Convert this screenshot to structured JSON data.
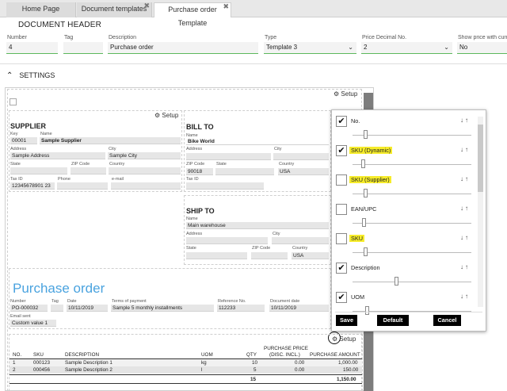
{
  "tabs": [
    {
      "label": "Home Page"
    },
    {
      "label": "Document templates"
    },
    {
      "label": "Purchase order Template"
    }
  ],
  "header": {
    "title": "DOCUMENT HEADER"
  },
  "fields": {
    "number": {
      "label": "Number",
      "value": "4"
    },
    "tag": {
      "label": "Tag",
      "value": ""
    },
    "description": {
      "label": "Description",
      "value": "Purchase order"
    },
    "type": {
      "label": "Type",
      "value": "Template 3"
    },
    "price_decimal": {
      "label": "Price Decimal No.",
      "value": "2"
    },
    "show_price": {
      "label": "Show price with curr",
      "value": "No"
    }
  },
  "settings": {
    "label": "SETTINGS"
  },
  "setup_label": "Setup",
  "supplier": {
    "title": "SUPPLIER",
    "key_label": "Key",
    "key": "00001",
    "name_label": "Name",
    "name": "Sample Supplier",
    "address_label": "Address",
    "address": "Sample Address",
    "city_label": "City",
    "city": "Sample City",
    "state_label": "State",
    "zip_label": "ZIP Code",
    "country_label": "Country",
    "taxid_label": "Tax ID",
    "taxid": "12345678901 23",
    "phone_label": "Phone",
    "email_label": "e-mail"
  },
  "billto": {
    "title": "BILL TO",
    "name_label": "Name",
    "name": "Bike World",
    "address_label": "Address",
    "city_label": "City",
    "zip_label": "ZIP Code",
    "zip": "90018",
    "state_label": "State",
    "country_label": "Country",
    "country": "USA",
    "taxid_label": "Tax ID"
  },
  "shipto": {
    "title": "SHIP TO",
    "name_label": "Name",
    "name": "Main warehouse",
    "address_label": "Address",
    "city_label": "City",
    "state_label": "State",
    "zip_label": "ZIP Code",
    "country_label": "Country",
    "country": "USA"
  },
  "po": {
    "title": "Purchase order",
    "number_label": "Number",
    "number": "PO-000032",
    "tag_label": "Tag",
    "date_label": "Date",
    "date": "10/11/2019",
    "terms_label": "Terms of payment",
    "terms": "Sample 5 monthly installments",
    "ref_label": "Reference No.",
    "ref": "112233",
    "docdate_label": "Document date",
    "docdate": "10/11/2019",
    "email_label": "Email sent",
    "email": "Custom value 1"
  },
  "table": {
    "headers": {
      "no": "NO.",
      "sku": "SKU",
      "description": "DESCRIPTION",
      "uom": "UOM",
      "qty": "QTY",
      "price1": "PURCHASE PRICE",
      "price2": "(DISC. INCL.)",
      "amount": "PURCHASE AMOUNT"
    },
    "rows": [
      {
        "no": "1",
        "sku": "000123",
        "description": "Sample Description 1",
        "uom": "kg",
        "qty": "10",
        "price": "0.00",
        "amount": "1,000.00"
      },
      {
        "no": "2",
        "sku": "000456",
        "description": "Sample Description 2",
        "uom": "l",
        "qty": "5",
        "price": "0.00",
        "amount": "150.00"
      }
    ],
    "total_qty": "15",
    "total_amount": "1,150.00"
  },
  "columns_panel": {
    "items": [
      {
        "label": "No.",
        "checked": true,
        "highlight": false
      },
      {
        "label": "SKU (Dynamic)",
        "checked": true,
        "highlight": true
      },
      {
        "label": "SKU (Supplier)",
        "checked": false,
        "highlight": true
      },
      {
        "label": "EAN/UPC",
        "checked": false,
        "highlight": false
      },
      {
        "label": "SKU",
        "checked": false,
        "highlight": true
      },
      {
        "label": "Description",
        "checked": true,
        "highlight": false
      },
      {
        "label": "UOM",
        "checked": true,
        "highlight": false
      }
    ],
    "arrows": "↓↑",
    "buttons": {
      "save": "Save",
      "default": "Default",
      "cancel": "Cancel"
    }
  },
  "icons": {
    "check": "✔",
    "gear": "⚙",
    "chevron_up": "⌃",
    "close": "✖",
    "dropdown": "⌄"
  }
}
